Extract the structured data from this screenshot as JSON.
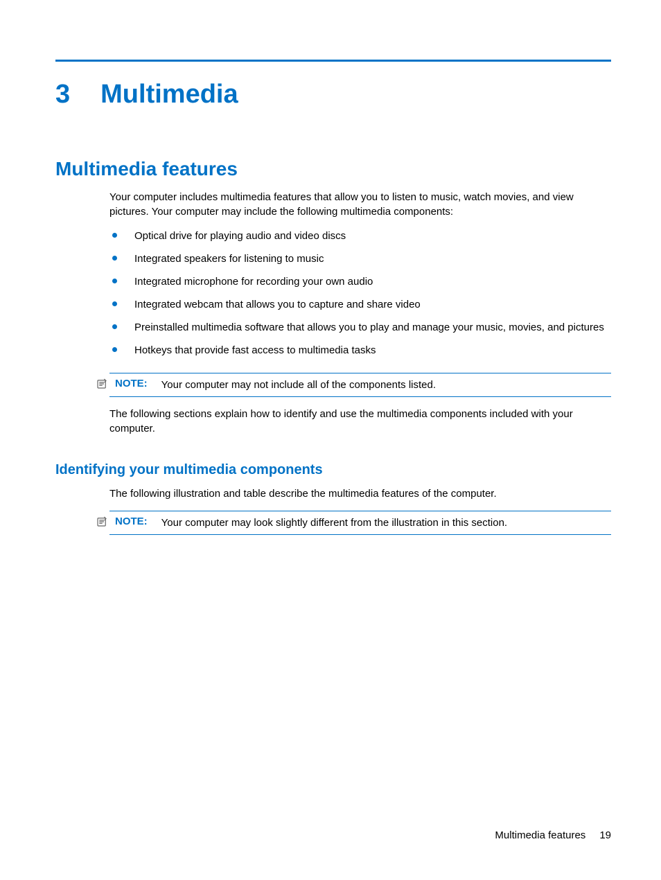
{
  "chapter": {
    "number": "3",
    "title": "Multimedia"
  },
  "section": {
    "heading": "Multimedia features",
    "intro": "Your computer includes multimedia features that allow you to listen to music, watch movies, and view pictures. Your computer may include the following multimedia components:",
    "bullets": [
      "Optical drive for playing audio and video discs",
      "Integrated speakers for listening to music",
      "Integrated microphone for recording your own audio",
      "Integrated webcam that allows you to capture and share video",
      "Preinstalled multimedia software that allows you to play and manage your music, movies, and pictures",
      "Hotkeys that provide fast access to multimedia tasks"
    ],
    "note1_label": "NOTE:",
    "note1_text": "Your computer may not include all of the components listed.",
    "after_note": "The following sections explain how to identify and use the multimedia components included with your computer."
  },
  "subsection": {
    "heading": "Identifying your multimedia components",
    "intro": "The following illustration and table describe the multimedia features of the computer.",
    "note2_label": "NOTE:",
    "note2_text": "Your computer may look slightly different from the illustration in this section."
  },
  "footer": {
    "text": "Multimedia features",
    "page": "19"
  }
}
